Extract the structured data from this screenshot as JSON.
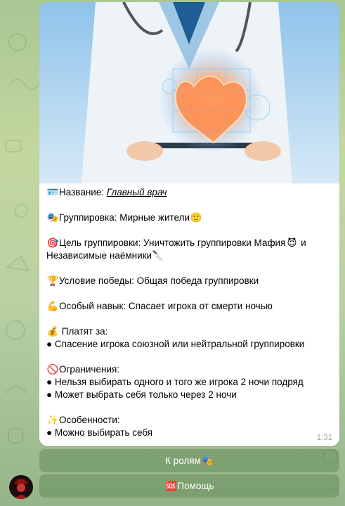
{
  "message": {
    "name_label": "Название: ",
    "name_value": "Главный врач",
    "faction": "Группировка: Мирные жители",
    "goal_line1": "Цель группировки: Уничтожить группировки Мафия",
    "goal_line1_end": " и",
    "goal_line2": "Независимые наёмники",
    "win_condition": "Условие победы: Общая победа группировки",
    "skill": "Особый навык: Спасает игрока от смерти ночью",
    "paid_header": " Платят за:",
    "paid_items": [
      "● Спасение игрока союзной или нейтральной группировки"
    ],
    "limits_header": "Ограничения:",
    "limits_items": [
      "● Нельзя выбирать одного и того же игрока 2 ночи подряд",
      "● Может выбрать себя только через 2 ночи"
    ],
    "features_header": "Особенности:",
    "features_items": [
      "● Можно выбирать себя"
    ],
    "time": "1:31"
  },
  "keyboard": {
    "roles_button": "К ролям",
    "help_button": "Помощь"
  },
  "icons": [
    "id-card-icon",
    "theater-masks-icon",
    "slightly-smiling-face-icon",
    "dart-target-icon",
    "smiling-devil-icon",
    "knife-icon",
    "trophy-icon",
    "flexed-biceps-icon",
    "money-bag-icon",
    "no-entry-icon",
    "sparkles-icon",
    "sos-icon"
  ],
  "colors": {
    "accent": "#3390ec",
    "keyboard_button": "#6e9a5f"
  }
}
